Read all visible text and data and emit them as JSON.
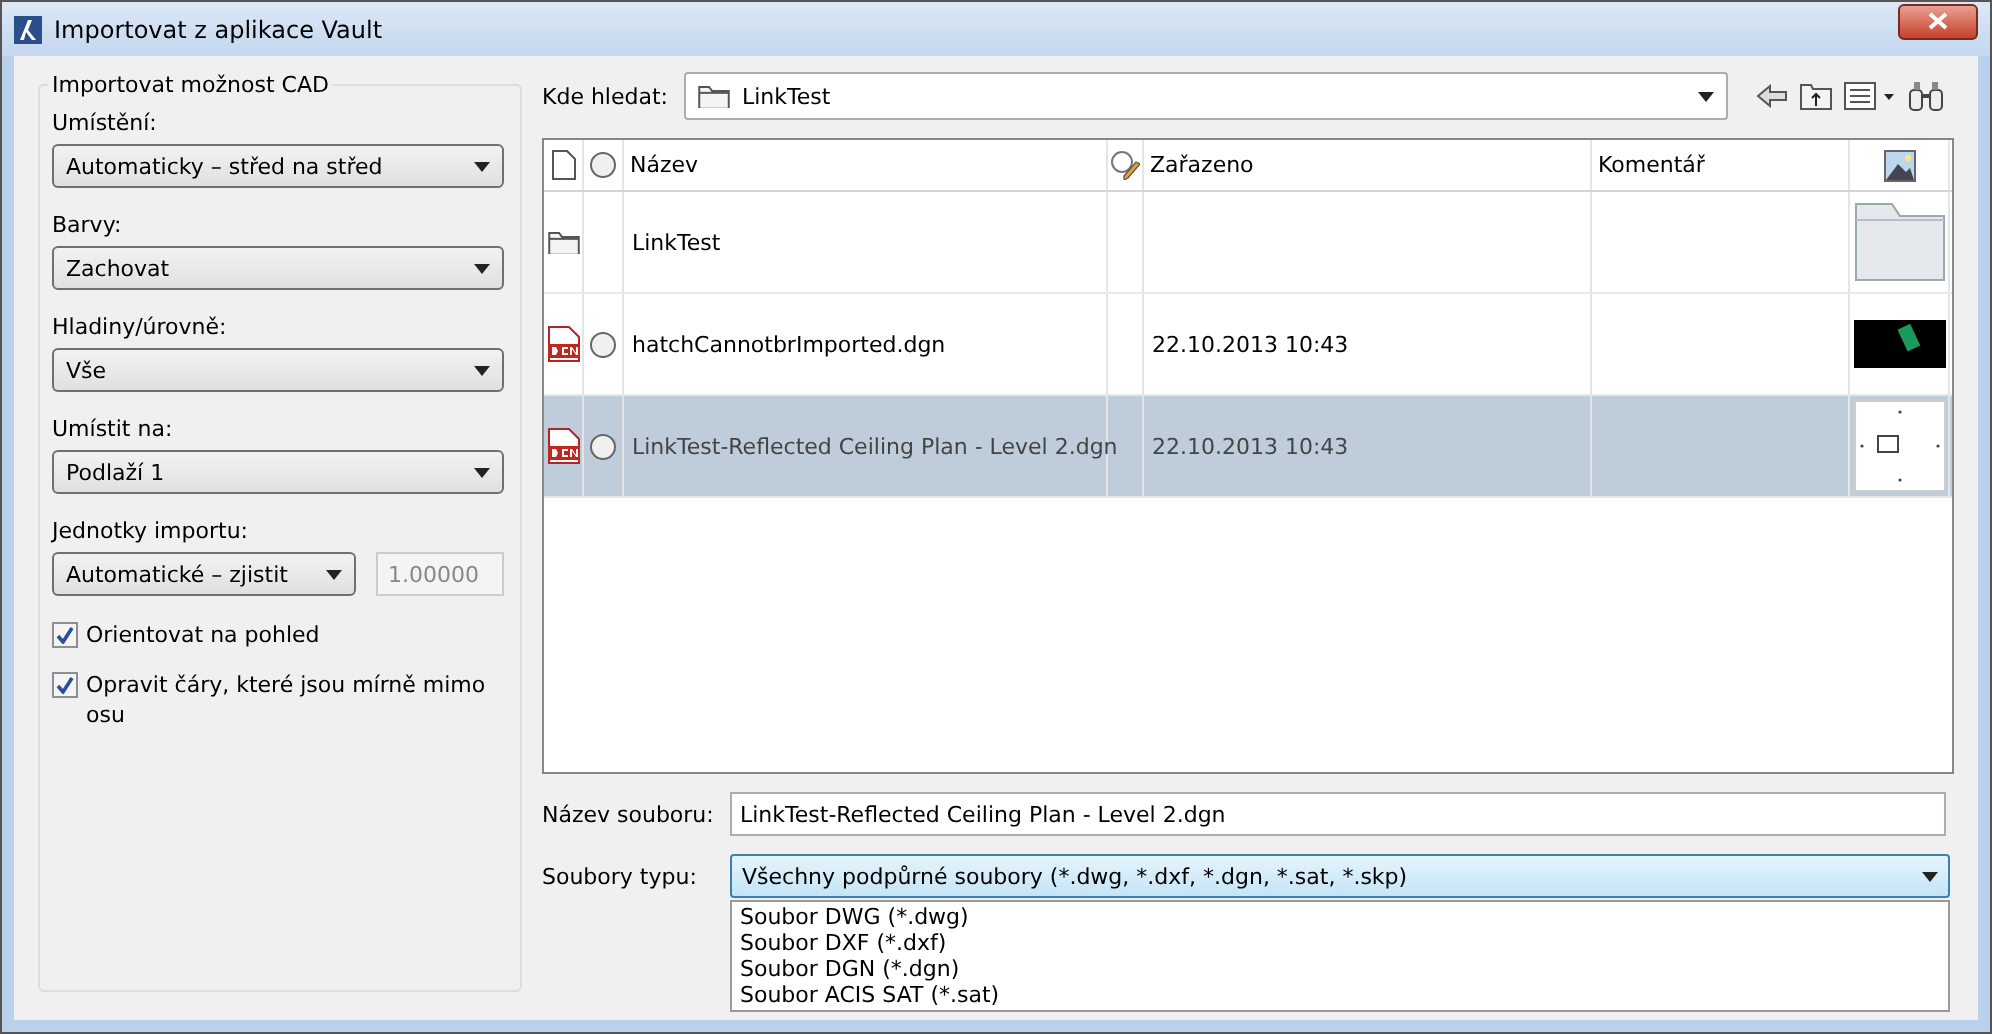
{
  "window": {
    "title": "Importovat z aplikace Vault"
  },
  "options": {
    "title": "Importovat možnost CAD",
    "fields": [
      {
        "kind": "select",
        "label": "Umístění:",
        "value": "Automaticky – střed na střed"
      },
      {
        "kind": "select",
        "label": "Barvy:",
        "value": "Zachovat"
      },
      {
        "kind": "select",
        "label": "Hladiny/úrovně:",
        "value": "Vše"
      },
      {
        "kind": "select",
        "label": "Umístit na:",
        "value": "Podlaží 1"
      },
      {
        "kind": "units",
        "label": "Jednotky importu:",
        "value": "Automatické – zjistit",
        "scale": "1.00000"
      }
    ],
    "checkboxes": [
      {
        "label": "Orientovat na pohled",
        "checked": true
      },
      {
        "label": "Opravit čáry, které jsou mírně mimo osu",
        "checked": true
      }
    ]
  },
  "look_in": {
    "label": "Kde hledat:",
    "value": "LinkTest"
  },
  "table": {
    "columns": [
      "Název",
      "Zařazeno",
      "Komentář"
    ],
    "rows": [
      {
        "kind": "folder",
        "name": "LinkTest",
        "selected": false
      },
      {
        "kind": "hatch",
        "name": "hatchCannotbrImported.dgn",
        "date": "22.10.2013 10:43",
        "selected": false
      },
      {
        "kind": "plan",
        "name": "LinkTest-Reflected Ceiling Plan - Level 2.dgn",
        "date": "22.10.2013 10:43",
        "selected": true
      }
    ]
  },
  "file_name": {
    "label": "Název souboru:",
    "value": "LinkTest-Reflected Ceiling Plan - Level 2.dgn"
  },
  "file_type": {
    "label": "Soubory typu:",
    "value": "Všechny podpůrné soubory (*.dwg, *.dxf, *.dgn, *.sat, *.skp)",
    "options": [
      "Soubor DWG (*.dwg)",
      "Soubor DXF (*.dxf)",
      "Soubor DGN (*.dgn)",
      "Soubor ACIS SAT (*.sat)"
    ]
  }
}
